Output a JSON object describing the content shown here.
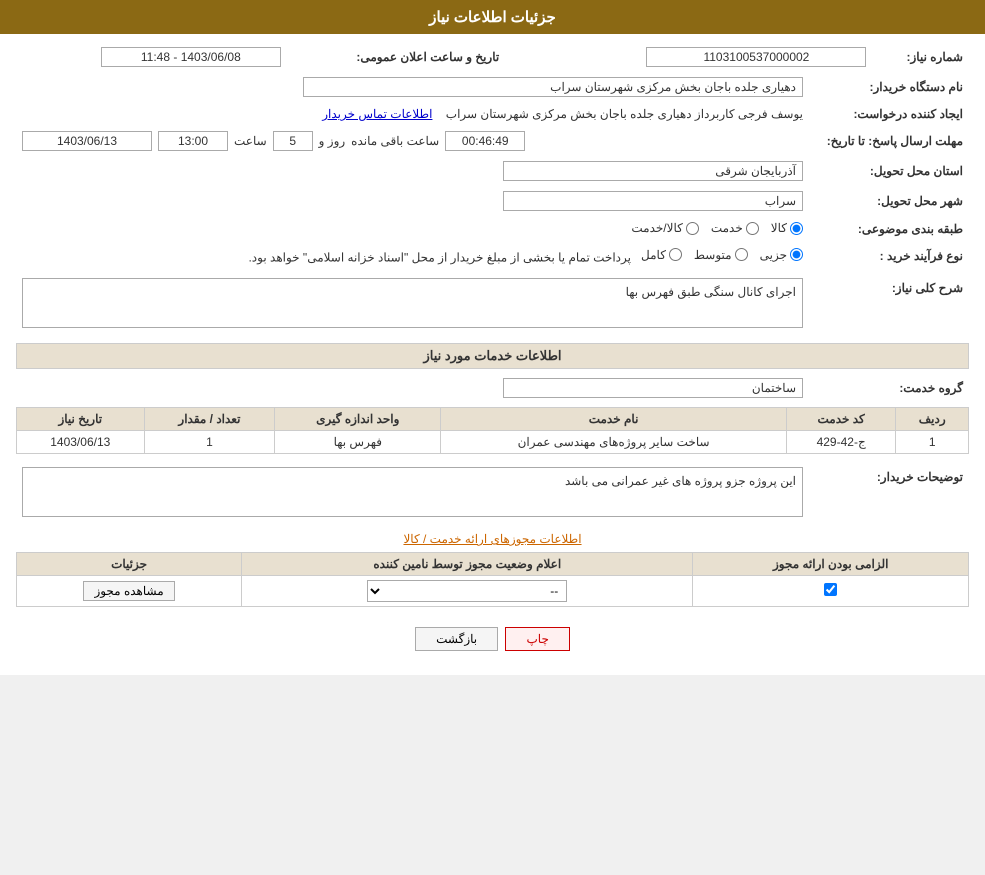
{
  "header": {
    "title": "جزئیات اطلاعات نیاز"
  },
  "form": {
    "need_number_label": "شماره نیاز:",
    "need_number_value": "1103100537000002",
    "announce_datetime_label": "تاریخ و ساعت اعلان عمومی:",
    "announce_datetime_value": "1403/06/08 - 11:48",
    "buyer_org_label": "نام دستگاه خریدار:",
    "buyer_org_value": "دهیاری جلده باجان بخش مرکزی شهرستان سراب",
    "creator_label": "ایجاد کننده درخواست:",
    "creator_value": "یوسف فرجی کاربرداز دهیاری جلده باجان بخش مرکزی شهرستان سراب",
    "contact_link": "اطلاعات تماس خریدار",
    "response_deadline_label": "مهلت ارسال پاسخ: تا تاریخ:",
    "response_date_value": "1403/06/13",
    "response_time_label": "ساعت",
    "response_time_value": "13:00",
    "response_days_label": "روز و",
    "response_days_value": "5",
    "response_remaining_label": "ساعت باقی مانده",
    "response_remaining_value": "00:46:49",
    "province_label": "استان محل تحویل:",
    "province_value": "آذربایجان شرقی",
    "city_label": "شهر محل تحویل:",
    "city_value": "سراب",
    "category_label": "طبقه بندی موضوعی:",
    "category_options": [
      "کالا",
      "خدمت",
      "کالا/خدمت"
    ],
    "category_selected": "کالا",
    "purchase_type_label": "نوع فرآیند خرید :",
    "purchase_type_options": [
      "جزیی",
      "متوسط",
      "کامل"
    ],
    "purchase_type_note": "پرداخت تمام یا بخشی از مبلغ خریدار از محل \"اسناد خزانه اسلامی\" خواهد بود.",
    "need_desc_label": "شرح کلی نیاز:",
    "need_desc_value": "اجرای کانال سنگی طبق فهرس بها",
    "services_section_label": "اطلاعات خدمات مورد نیاز",
    "service_group_label": "گروه خدمت:",
    "service_group_value": "ساختمان",
    "table": {
      "col_row": "ردیف",
      "col_code": "کد خدمت",
      "col_name": "نام خدمت",
      "col_unit": "واحد اندازه گیری",
      "col_qty": "تعداد / مقدار",
      "col_date": "تاریخ نیاز",
      "rows": [
        {
          "row": "1",
          "code": "ج-42-429",
          "name": "ساخت سایر پروژه‌های مهندسی عمران",
          "unit": "فهرس بها",
          "qty": "1",
          "date": "1403/06/13"
        }
      ]
    },
    "buyer_notes_label": "توضیحات خریدار:",
    "buyer_notes_value": "این پروژه جزو پروژه های غیر عمرانی می باشد",
    "permits_section_label": "اطلاعات مجوزهای ارائه خدمت / کالا",
    "permits_table": {
      "col_mandatory": "الزامی بودن ارائه مجوز",
      "col_status": "اعلام وضعیت مجوز توسط نامین کننده",
      "col_details": "جزئیات",
      "rows": [
        {
          "mandatory": true,
          "status": "--",
          "details": "مشاهده مجوز"
        }
      ]
    }
  },
  "buttons": {
    "print": "چاپ",
    "back": "بازگشت"
  }
}
